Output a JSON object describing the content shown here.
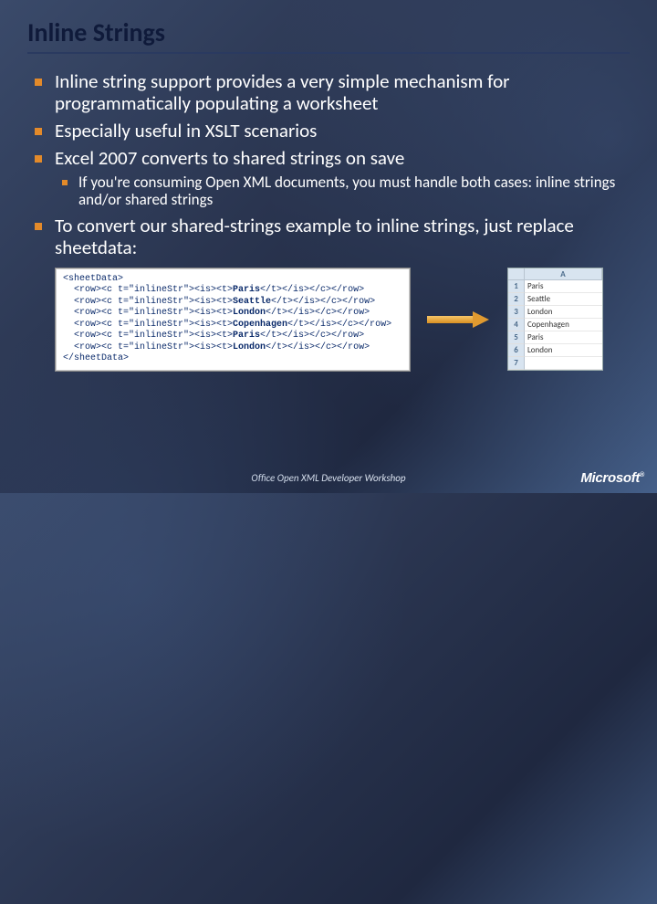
{
  "title": "Inline Strings",
  "bullets": {
    "b1": "Inline string support provides a very simple mechanism for programmatically populating a worksheet",
    "b2": "Especially useful in XSLT scenarios",
    "b3": "Excel 2007 converts to shared strings on save",
    "b3s1": "If you're consuming Open XML documents, you must handle both cases: inline strings and/or shared strings",
    "b4": "To convert our shared-strings example to inline strings, just replace sheetdata:"
  },
  "code": {
    "open": "<sheetData>",
    "pre": "  <row><c t=\"inlineStr\"><is><t>",
    "post": "</t></is></c></row>",
    "vals": [
      "Paris",
      "Seattle",
      "London",
      "Copenhagen",
      "Paris",
      "London"
    ],
    "close": "</sheetData>"
  },
  "sheet": {
    "col": "A",
    "rows": [
      "Paris",
      "Seattle",
      "London",
      "Copenhagen",
      "Paris",
      "London",
      ""
    ]
  },
  "footer": "Office Open XML Developer Workshop",
  "logo": "Microsoft"
}
